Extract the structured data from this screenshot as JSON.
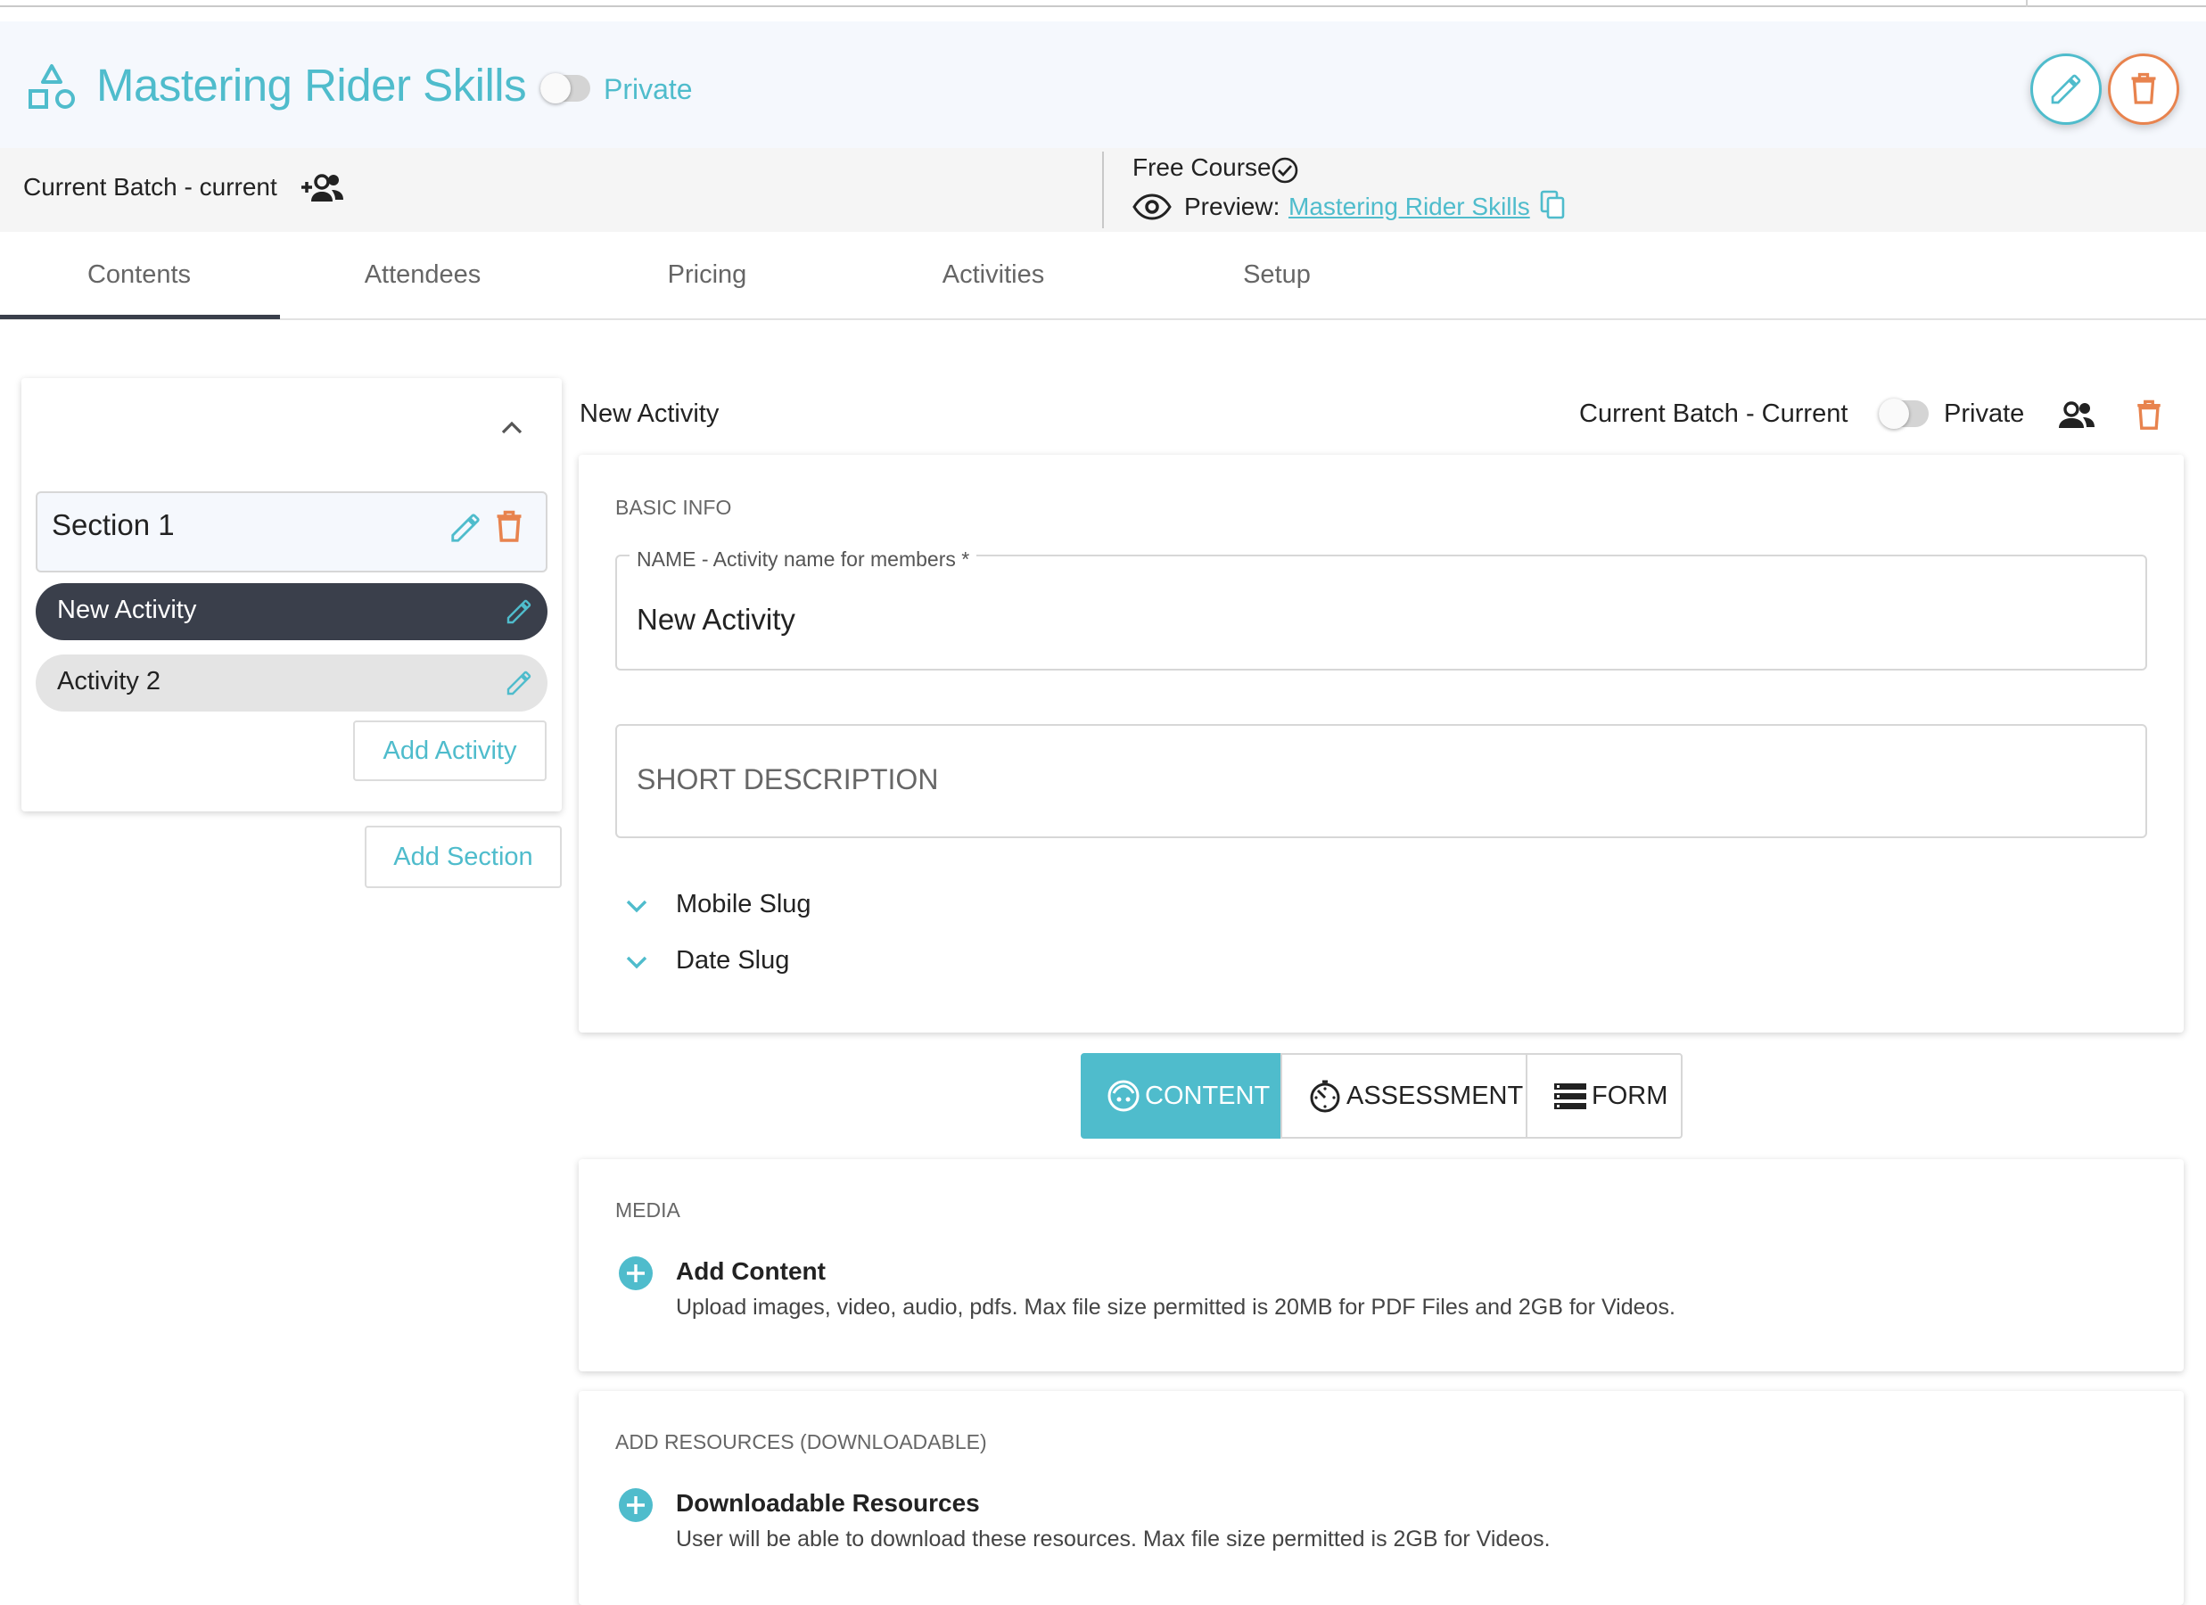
{
  "header": {
    "course_title": "Mastering Rider Skills",
    "private_label": "Private",
    "logo_icon": "shapes-icon",
    "edit_icon": "pencil-icon",
    "delete_icon": "trash-icon"
  },
  "batch_bar": {
    "batch_label": "Current Batch - current",
    "free_course_label": "Free Course",
    "preview_label": "Preview:",
    "preview_link": "Mastering Rider Skills"
  },
  "tabs": [
    {
      "label": "Contents",
      "active": true
    },
    {
      "label": "Attendees",
      "active": false
    },
    {
      "label": "Pricing",
      "active": false
    },
    {
      "label": "Activities",
      "active": false
    },
    {
      "label": "Setup",
      "active": false
    }
  ],
  "sidebar": {
    "section_label": "Section 1",
    "activities": [
      {
        "label": "New Activity",
        "selected": true
      },
      {
        "label": "Activity 2",
        "selected": false
      }
    ],
    "add_activity_label": "Add Activity",
    "add_section_label": "Add Section"
  },
  "activity_header": {
    "title": "New Activity",
    "batch_label": "Current Batch - Current",
    "private_label": "Private"
  },
  "basic_info": {
    "heading": "BASIC INFO",
    "name_label": "NAME - Activity name for members *",
    "name_value": "New Activity",
    "short_description_placeholder": "SHORT DESCRIPTION",
    "mobile_slug_label": "Mobile Slug",
    "date_slug_label": "Date Slug"
  },
  "content_type": {
    "options": [
      {
        "label": "CONTENT",
        "selected": true
      },
      {
        "label": "ASSESSMENT",
        "selected": false
      },
      {
        "label": "FORM",
        "selected": false
      }
    ]
  },
  "media": {
    "heading": "MEDIA",
    "add_title": "Add Content",
    "add_description": "Upload images, video, audio, pdfs. Max file size permitted is 20MB for PDF Files and 2GB for Videos."
  },
  "resources": {
    "heading": "ADD RESOURCES (DOWNLOADABLE)",
    "add_title": "Downloadable Resources",
    "add_description": "User will be able to download these resources. Max file size permitted is 2GB for Videos."
  },
  "colors": {
    "accent": "#4fbccc",
    "danger": "#e8834e",
    "dark_pill": "#3a3f4b",
    "header_bg": "#f5f8fd"
  }
}
